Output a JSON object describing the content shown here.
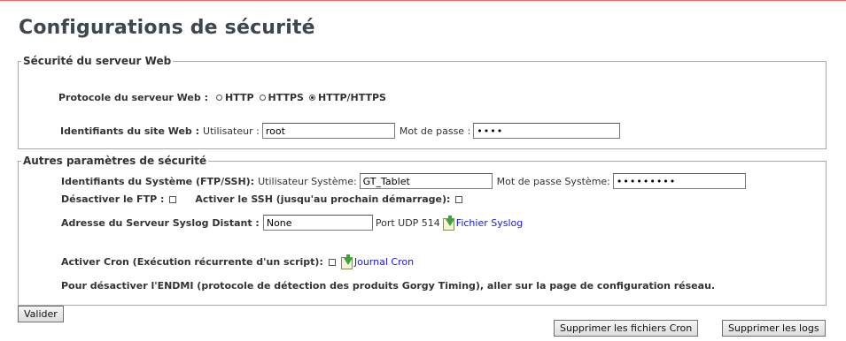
{
  "page": {
    "title": "Configurations de sécurité"
  },
  "web_server": {
    "legend": "Sécurité du serveur Web",
    "protocol_label": "Protocole du serveur Web :",
    "protocols": [
      {
        "label": "HTTP",
        "checked": false
      },
      {
        "label": "HTTPS",
        "checked": false
      },
      {
        "label": "HTTP/HTTPS",
        "checked": true
      }
    ],
    "credentials_label": "Identifiants du site Web :",
    "user_label": "Utilisateur :",
    "user_value": "root",
    "password_label": "Mot de passe :",
    "password_value": "••••"
  },
  "other": {
    "legend": "Autres paramètres de sécurité",
    "system_label": "Identifiants du Système (FTP/SSH):",
    "system_user_label": "Utilisateur Système:",
    "system_user_value": "GT_Tablet",
    "system_password_label": "Mot de passe Système:",
    "system_password_value": "•••••••••",
    "ftp_label": "Désactiver le FTP :",
    "ssh_label": "Activer le SSH (jusqu'au prochain démarrage):",
    "syslog_label": "Adresse du Serveur Syslog Distant :",
    "syslog_value": "None",
    "syslog_port": "Port UDP 514",
    "syslog_link": "Fichier Syslog",
    "cron_label": "Activer Cron (Exécution récurrente d'un script):",
    "cron_link": "Journal Cron",
    "endmi_note": "Pour désactiver l'ENDMI (protocole de détection des produits Gorgy Timing), aller sur la page de configuration réseau."
  },
  "buttons": {
    "validate": "Valider",
    "delete_cron": "Supprimer les fichiers Cron",
    "delete_logs": "Supprimer les logs"
  }
}
